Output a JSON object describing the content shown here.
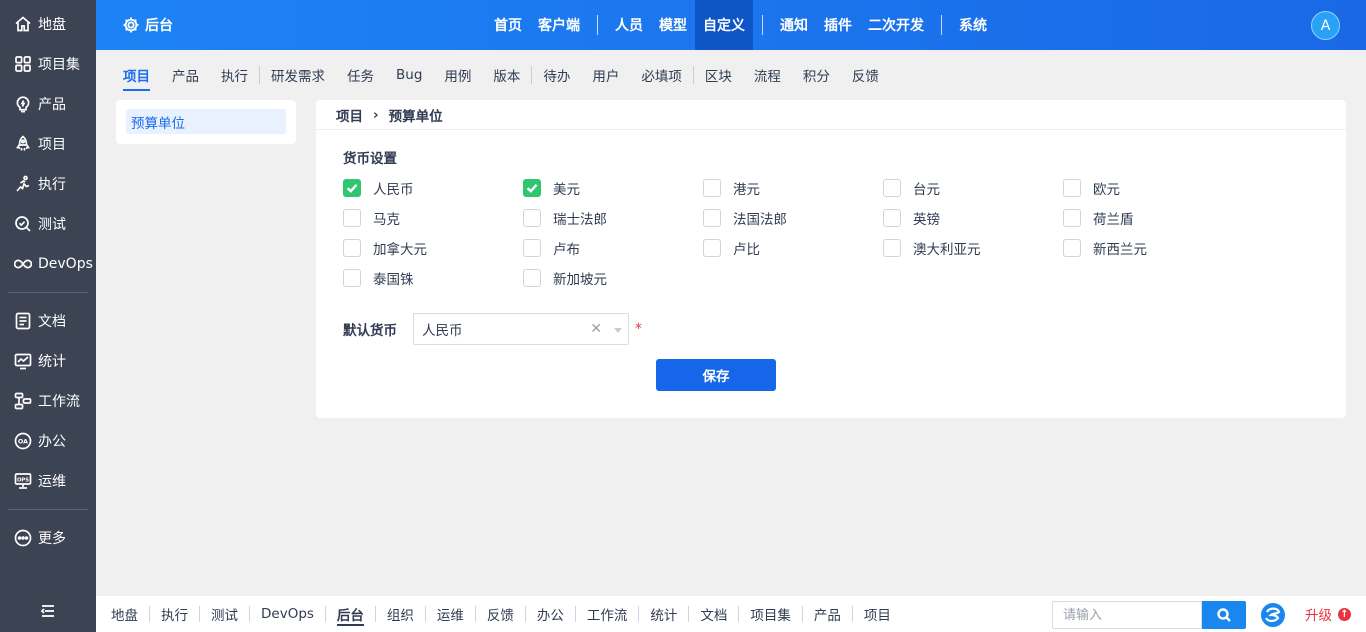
{
  "sidebar": {
    "items": [
      {
        "label": "地盘",
        "icon": "home-icon"
      },
      {
        "label": "项目集",
        "icon": "grid-icon"
      },
      {
        "label": "产品",
        "icon": "bulb-icon"
      },
      {
        "label": "项目",
        "icon": "rocket-icon"
      },
      {
        "label": "执行",
        "icon": "run-icon"
      },
      {
        "label": "测试",
        "icon": "test-icon"
      },
      {
        "label": "DevOps",
        "icon": "infinity-icon"
      }
    ],
    "items2": [
      {
        "label": "文档",
        "icon": "doc-icon"
      },
      {
        "label": "统计",
        "icon": "chart-icon"
      },
      {
        "label": "工作流",
        "icon": "workflow-icon"
      },
      {
        "label": "办公",
        "icon": "oa-icon"
      },
      {
        "label": "运维",
        "icon": "ops-icon"
      }
    ],
    "more": {
      "label": "更多",
      "icon": "more-icon"
    },
    "collapse_icon": "menu-collapse-icon"
  },
  "header": {
    "brand": "后台",
    "nav": [
      "首页",
      "客户端",
      "人员",
      "模型",
      "自定义",
      "通知",
      "插件",
      "二次开发",
      "系统"
    ],
    "active": "自定义",
    "avatar": "A"
  },
  "subnav": {
    "items": [
      "项目",
      "产品",
      "执行",
      "研发需求",
      "任务",
      "Bug",
      "用例",
      "版本",
      "待办",
      "用户",
      "必填项",
      "区块",
      "流程",
      "积分",
      "反馈"
    ],
    "active": "项目"
  },
  "tree": {
    "item": "预算单位"
  },
  "main": {
    "breadcrumb": [
      "项目",
      "预算单位"
    ],
    "section_title": "货币设置",
    "currencies": [
      {
        "label": "人民币",
        "checked": true
      },
      {
        "label": "美元",
        "checked": true
      },
      {
        "label": "港元",
        "checked": false
      },
      {
        "label": "台元",
        "checked": false
      },
      {
        "label": "欧元",
        "checked": false
      },
      {
        "label": "马克",
        "checked": false
      },
      {
        "label": "瑞士法郎",
        "checked": false
      },
      {
        "label": "法国法郎",
        "checked": false
      },
      {
        "label": "英镑",
        "checked": false
      },
      {
        "label": "荷兰盾",
        "checked": false
      },
      {
        "label": "加拿大元",
        "checked": false
      },
      {
        "label": "卢布",
        "checked": false
      },
      {
        "label": "卢比",
        "checked": false
      },
      {
        "label": "澳大利亚元",
        "checked": false
      },
      {
        "label": "新西兰元",
        "checked": false
      },
      {
        "label": "泰国铢",
        "checked": false
      },
      {
        "label": "新加坡元",
        "checked": false
      }
    ],
    "default_label": "默认货币",
    "default_value": "人民币",
    "required_mark": "*",
    "save_label": "保存"
  },
  "bottombar": {
    "items": [
      "地盘",
      "执行",
      "测试",
      "DevOps",
      "后台",
      "组织",
      "运维",
      "反馈",
      "办公",
      "工作流",
      "统计",
      "文档",
      "项目集",
      "产品",
      "项目"
    ],
    "active": "后台",
    "search_placeholder": "请输入",
    "upgrade": "升级"
  },
  "colors": {
    "primary": "#1a6cf0",
    "sidebar": "#3c4353",
    "checked": "#2ec76f",
    "danger": "#e8343f"
  }
}
